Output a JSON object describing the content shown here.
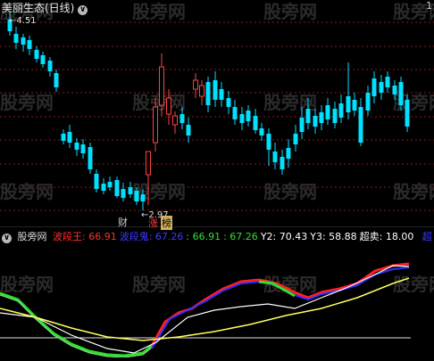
{
  "main": {
    "title": "美丽生态(日线)",
    "max_price_label": "4.51",
    "min_price_label": "2.97",
    "badge_cai": "财",
    "badge_zhang": "涨",
    "badge_bang": "榜",
    "corner_label": "1"
  },
  "indicator": {
    "name": "股旁网",
    "items": [
      {
        "label": "波段王:",
        "value": "66.91",
        "color": "#ff3030"
      },
      {
        "label": "波段鬼:",
        "value": "67.26",
        "color": "#3a3aff"
      },
      {
        "label": ":",
        "value": "66.91",
        "color": "#30e030"
      },
      {
        "label": ":",
        "value": "67.26",
        "color": "#30e030"
      },
      {
        "label": "Y2:",
        "value": "70.43",
        "color": "#ffffff"
      },
      {
        "label": "Y3:",
        "value": "58.88",
        "color": "#ffffff"
      },
      {
        "label": "超卖:",
        "value": "18.00",
        "color": "#ffffff"
      }
    ],
    "overflow_label": "超"
  },
  "watermark_text": "股旁网",
  "colors": {
    "up": "#ff4040",
    "down": "#00e0ff",
    "grid": "#8b1a1a",
    "line_red": "#ff2020",
    "line_blue": "#3030ff",
    "line_green": "#30e030",
    "line_white": "#ffffff",
    "line_yellow": "#ffff60"
  },
  "chart_data": {
    "type": "candlestick",
    "price_high_label": 4.51,
    "price_low_label": 2.97,
    "candles_close_pattern": "down-trend-then-rebound",
    "indicator_lines": [
      "波段王",
      "波段鬼",
      "Y2",
      "Y3",
      "超卖"
    ]
  }
}
